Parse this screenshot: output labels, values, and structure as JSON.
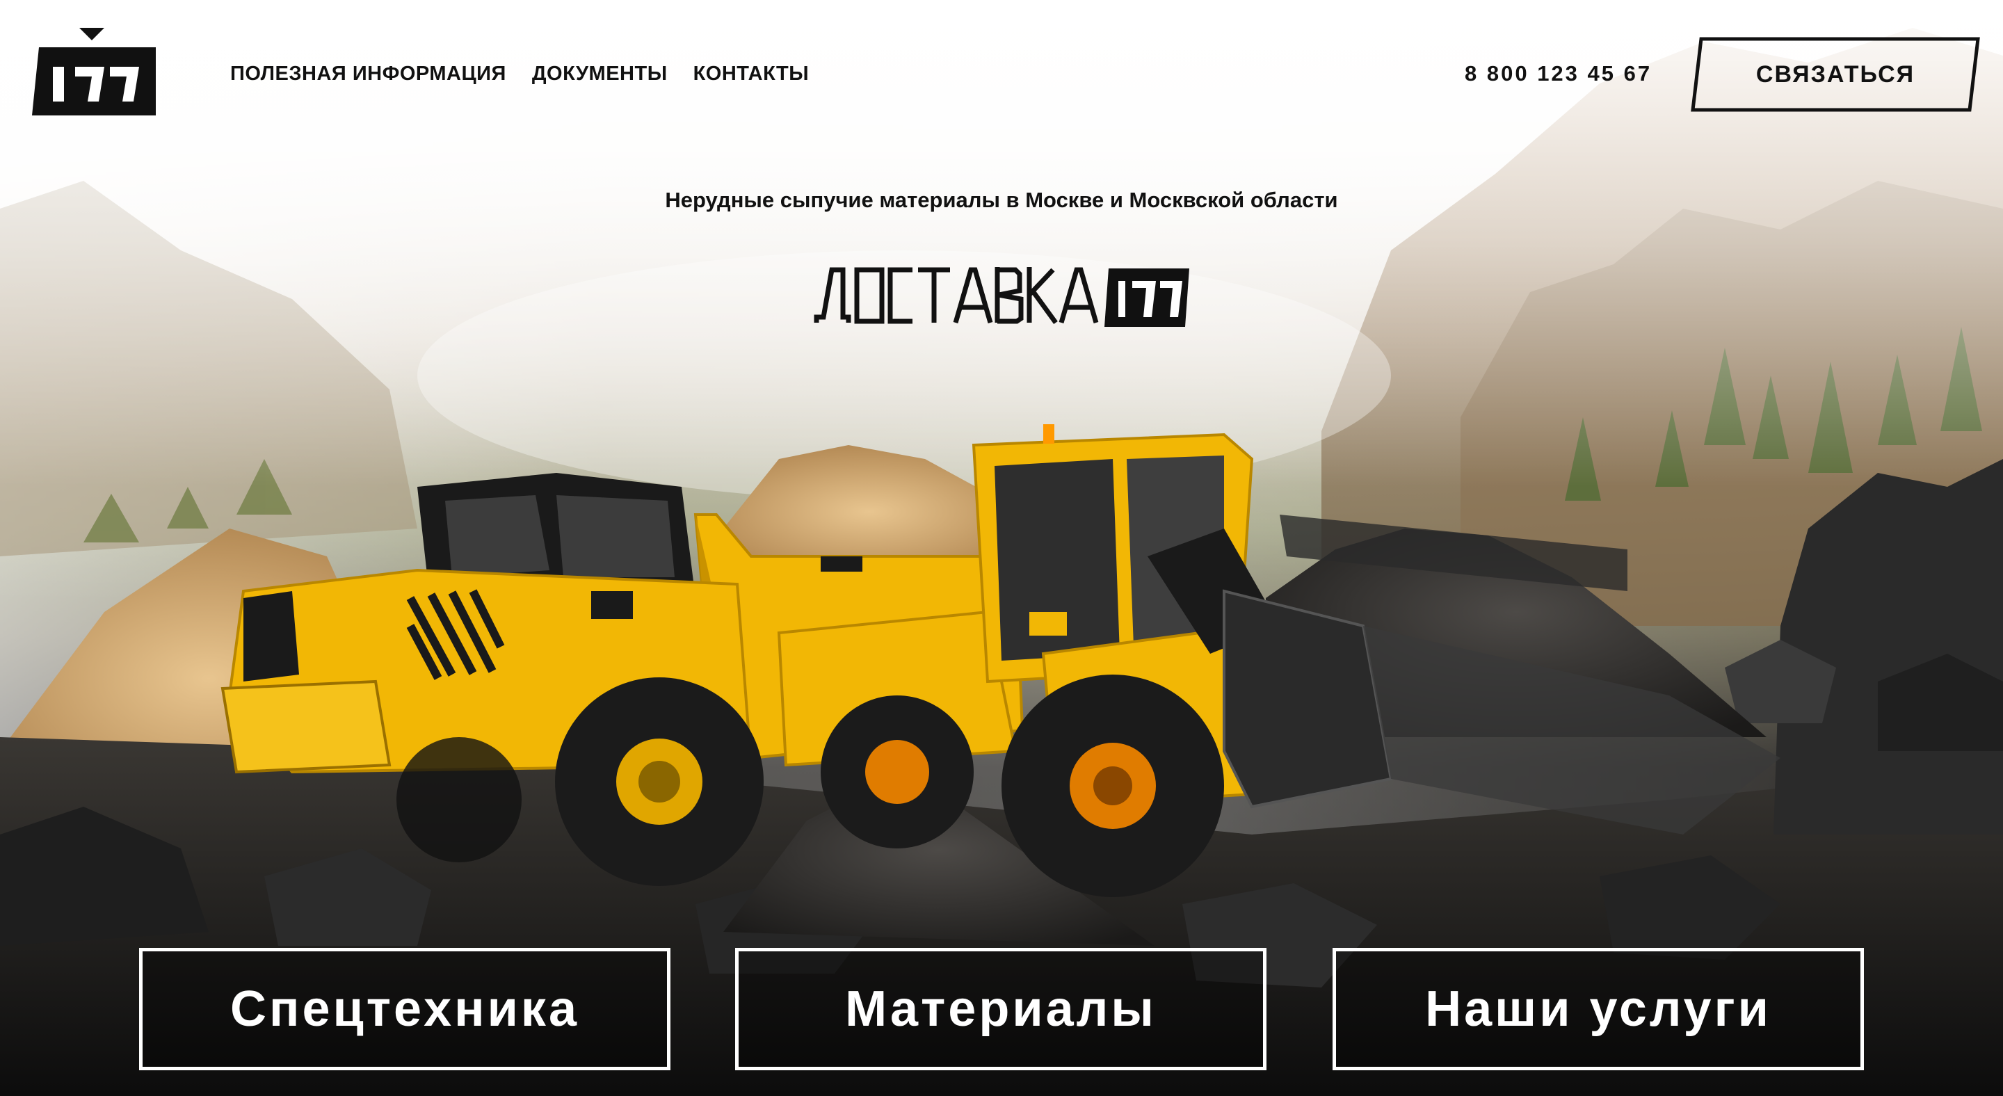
{
  "header": {
    "logo_text": "177",
    "nav": [
      {
        "label": "ПОЛЕЗНАЯ ИНФОРМАЦИЯ"
      },
      {
        "label": "ДОКУМЕНТЫ"
      },
      {
        "label": "КОНТАКТЫ"
      }
    ],
    "phone": "8 800 123 45 67",
    "contact_label": "СВЯЗАТЬСЯ"
  },
  "hero": {
    "subtitle": "Нерудные сыпучие материалы в Москве и Москвской области",
    "brand_word": "ДОСТАВКА",
    "brand_badge": "177",
    "vehicle_label": "ДОСТАВКА 177"
  },
  "categories": [
    {
      "label": "Спецтехника"
    },
    {
      "label": "Материалы"
    },
    {
      "label": "Наши услуги"
    }
  ],
  "colors": {
    "accent_yellow": "#f2b705",
    "text_dark": "#111111",
    "button_border": "#ffffff"
  }
}
